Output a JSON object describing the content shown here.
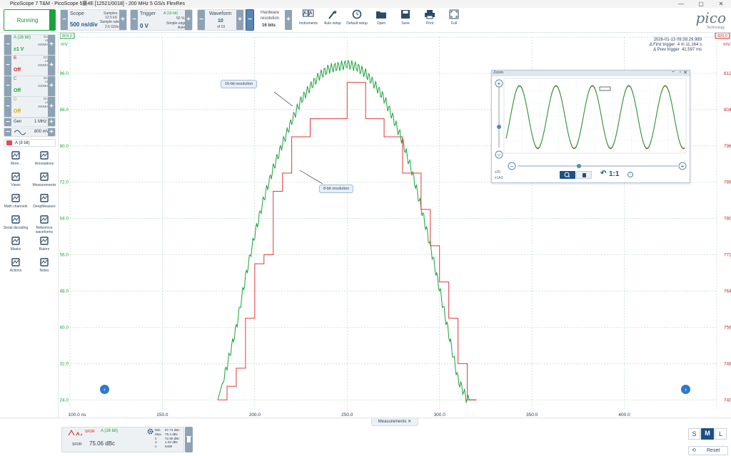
{
  "window": {
    "title": "PicoScope 7 T&M - PicoScope 5褰4E [12521/0018] - 200 MHz 5 GS/s FlexRes",
    "controls": [
      "—",
      "▢",
      "✕"
    ]
  },
  "toolbar": {
    "run": "Running",
    "scope": {
      "label": "Scope",
      "timebase": "500 ns/div",
      "samples_label": "Samples",
      "samples": "12.5 kS",
      "rate_label": "Sample rate",
      "rate": "2.5 GS/s"
    },
    "trigger": {
      "label": "Trigger",
      "level": "0 V",
      "channel": "A (16 bit)",
      "pct": "50 %",
      "type": "Simple edge",
      "mode": "Auto"
    },
    "waveform": {
      "label": "Waveform",
      "value": "10",
      "of": "of 10"
    },
    "hwres": {
      "label1": "Hardware",
      "label2": "resolution",
      "value": "16 bits"
    },
    "buttons": [
      "Instruments",
      "Auto setup",
      "Default setup",
      "Open",
      "Save",
      "Print",
      "Full"
    ]
  },
  "logo": {
    "text": "pico",
    "sub": "Technology"
  },
  "sidebar": {
    "channels": [
      {
        "name": "A (16 bit)",
        "coupling": "DC",
        "probe": "x1",
        "bw": "200MHz",
        "range": "±1 V",
        "color": "#1aa33a"
      },
      {
        "name": "B",
        "coupling": "DC",
        "probe": "x1",
        "bw": "200MHz",
        "range": "Off",
        "color": "#d52020"
      },
      {
        "name": "C",
        "coupling": "DC",
        "probe": "x1",
        "bw": "200MHz",
        "range": "Off",
        "color": "#1aa33a"
      },
      {
        "name": "D",
        "coupling": "DC",
        "probe": "x1",
        "bw": "200MHz",
        "range": "Off",
        "color": "#d8a400"
      }
    ],
    "gen": {
      "label": "Gen",
      "freq": "1 MHz",
      "amp": "800 mV"
    },
    "math_channel": "A (8 bit)",
    "tools": [
      "More..",
      "Annotations",
      "Views",
      "Measurements",
      "Math channels",
      "DeepMeasure",
      "Serial decoding",
      "Reference waveforms",
      "Masks",
      "Rulers",
      "Actions",
      "Notes"
    ]
  },
  "chart_data": {
    "type": "line",
    "x": [
      180,
      185,
      190,
      195,
      200,
      205,
      210,
      215,
      220,
      225,
      230,
      235,
      240,
      245,
      250,
      255,
      260,
      265,
      270,
      275,
      280,
      285,
      290,
      295,
      300,
      305,
      310,
      315,
      320
    ],
    "series": [
      {
        "name": "16-bit resolution",
        "color": "#1aa33a",
        "axis": "left",
        "values": [
          724.0,
          731.5,
          740.0,
          751.0,
          760.5,
          768.5,
          775.0,
          780.5,
          785.5,
          790.0,
          793.0,
          795.5,
          797.0,
          797.5,
          798.0,
          797.5,
          796.0,
          793.5,
          790.5,
          786.0,
          781.0,
          774.5,
          766.5,
          758.0,
          748.5,
          738.5,
          728.5,
          724.0,
          724.0
        ]
      },
      {
        "name": "8-bit resolution",
        "color": "#e03a3a",
        "axis": "right",
        "values": [
          740.0,
          743.0,
          747.0,
          758.0,
          770.0,
          772.0,
          786.0,
          790.0,
          798.0,
          798.0,
          802.0,
          802.0,
          802.0,
          802.0,
          810.0,
          810.0,
          802.0,
          802.0,
          798.0,
          798.0,
          790.0,
          790.0,
          782.0,
          774.0,
          766.0,
          758.0,
          748.0,
          740.0,
          740.0
        ]
      }
    ],
    "x_ticks": [
      "100.0 ns",
      "150.0",
      "200.0",
      "250.0",
      "300.0",
      "350.0",
      "400.0"
    ],
    "y_left_ticks": [
      "796.0",
      "788.0",
      "780.0",
      "772.0",
      "764.0",
      "756.0",
      "748.0",
      "740.0",
      "732.0",
      "724.0"
    ],
    "y_right_ticks": [
      "812.0",
      "804.0",
      "796.0",
      "788.0",
      "780.0",
      "772.0",
      "764.0",
      "756.0",
      "748.0",
      "740.0"
    ],
    "y_left_unit": "mV",
    "y_right_unit": "mV",
    "left_top_badge": "804.0",
    "right_top_badge": "820.0",
    "grid": true
  },
  "info": {
    "date": "2026-01-13 09:38:29.989",
    "first_label": "Δ First trigger",
    "first": "4 m 11.164 s",
    "prev_label": "Δ Prev trigger",
    "prev": "41.597 ms"
  },
  "callouts": [
    "16-bit resolution",
    "8-bit resolution"
  ],
  "zoom": {
    "title": "Zoom",
    "zx": "x25",
    "zy": "x1A3",
    "ratio": "1:1"
  },
  "bottom": {
    "tab": "Measurements",
    "meas_type": "SFDR",
    "meas_channel": "A (16 bit)",
    "meas_label": "SFDR",
    "meas_value": "75.06 dBc",
    "stats": [
      [
        "Min.",
        "67.74 dBc"
      ],
      [
        "Max.",
        "75.4 dBc"
      ],
      [
        "x̄",
        "72.95 dBc"
      ],
      [
        "σ",
        "1.02 dBc"
      ],
      [
        "n",
        "5490"
      ]
    ],
    "sizes": [
      "S",
      "M",
      "L"
    ],
    "reset": "Reset"
  }
}
